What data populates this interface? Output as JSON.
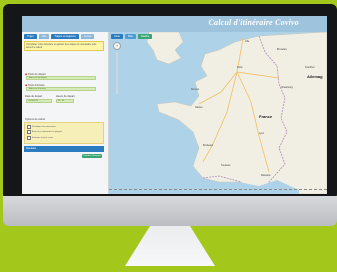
{
  "app_title": "Calcul d'itinéraire Covivo",
  "sidebar": {
    "tabs": [
      "Trajet",
      "Ville",
      "Trajets enregistrés",
      "Autres"
    ],
    "info_text": "Complétez votre itinéraire et ajoutez des étapes si nécessaire puis lancez le calcul",
    "departure": {
      "label": "Point de départ",
      "value": "Adresse de départ"
    },
    "arrival": {
      "label": "Point d'arrivée",
      "value": "Adresse d'arrivée"
    },
    "date": {
      "label": "Date du départ",
      "value": "15/06/2014"
    },
    "time": {
      "label": "Heure de départ",
      "value": "08 : 30"
    },
    "options_title": "Options de calcul",
    "options": [
      "Privilégier les autoroutes",
      "Éviter les autoroutes et péages",
      "Itinéraire le plus court"
    ],
    "results_label": "Résultats",
    "calc_button": "Calculer l'itinéraire"
  },
  "map": {
    "tabs": [
      "Carte",
      "Plan",
      "Satellite"
    ],
    "zoom_label": "+",
    "labels": {
      "country_france": "France",
      "country_allemagne": "Allemag",
      "paris": "Paris",
      "lille": "Lille",
      "nantes": "Nantes",
      "lyon": "Lyon",
      "bordeaux": "Bordeaux",
      "marseille": "Marseille",
      "toulouse": "Toulouse",
      "strasbourg": "Strasbourg",
      "rennes": "Rennes",
      "frankfurt": "Frankfurt",
      "bruxelles": "Bruxelles"
    }
  },
  "colors": {
    "background": "#a4c71b",
    "titlebar": "#9ec3dc",
    "tab_blue": "#2b7bbf",
    "button_green": "#3aa572",
    "sea": "#aed3e8",
    "land": "#f1eee4"
  }
}
